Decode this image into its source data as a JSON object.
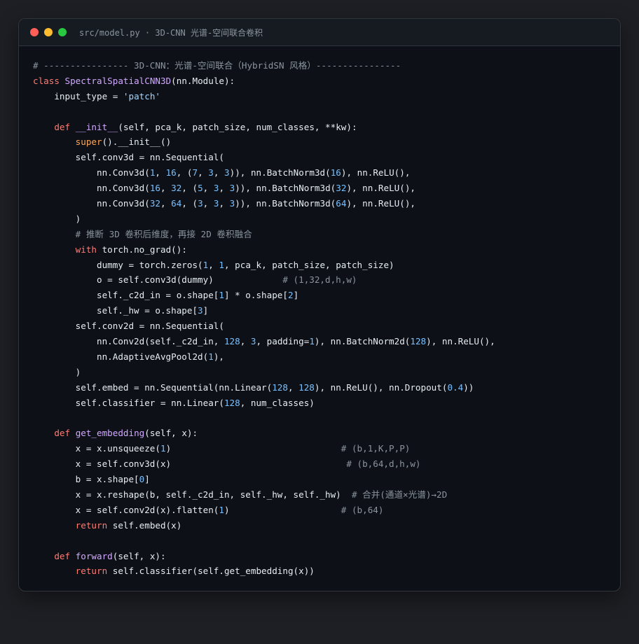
{
  "window": {
    "title": "src/model.py · 3D-CNN 光谱-空间联合卷积"
  },
  "colors": {
    "keyword": "#ff7b72",
    "function": "#d2a8ff",
    "number": "#79c0ff",
    "string": "#a5d6ff",
    "comment": "#8b949e",
    "builtin": "#ffa657",
    "text": "#e6edf3"
  },
  "code_lines": [
    [
      [
        "cm",
        "# ---------------- 3D-CNN：光谱-空间联合（HybridSN 风格）----------------"
      ]
    ],
    [
      [
        "kw",
        "class "
      ],
      [
        "fn",
        "SpectralSpatialCNN3D"
      ],
      [
        "tx",
        "(nn.Module):"
      ]
    ],
    [
      [
        "tx",
        "    input_type = "
      ],
      [
        "str",
        "'patch'"
      ]
    ],
    [],
    [
      [
        "tx",
        "    "
      ],
      [
        "kw",
        "def "
      ],
      [
        "fn",
        "__init__"
      ],
      [
        "tx",
        "(self, pca_k, patch_size, num_classes, **kw):"
      ]
    ],
    [
      [
        "tx",
        "        "
      ],
      [
        "bi",
        "super"
      ],
      [
        "tx",
        "().__init__()"
      ]
    ],
    [
      [
        "tx",
        "        self.conv3d = nn.Sequential("
      ]
    ],
    [
      [
        "tx",
        "            nn.Conv3d("
      ],
      [
        "num",
        "1"
      ],
      [
        "tx",
        ", "
      ],
      [
        "num",
        "16"
      ],
      [
        "tx",
        ", ("
      ],
      [
        "num",
        "7"
      ],
      [
        "tx",
        ", "
      ],
      [
        "num",
        "3"
      ],
      [
        "tx",
        ", "
      ],
      [
        "num",
        "3"
      ],
      [
        "tx",
        ")), nn.BatchNorm3d("
      ],
      [
        "num",
        "16"
      ],
      [
        "tx",
        "), nn.ReLU(),"
      ]
    ],
    [
      [
        "tx",
        "            nn.Conv3d("
      ],
      [
        "num",
        "16"
      ],
      [
        "tx",
        ", "
      ],
      [
        "num",
        "32"
      ],
      [
        "tx",
        ", ("
      ],
      [
        "num",
        "5"
      ],
      [
        "tx",
        ", "
      ],
      [
        "num",
        "3"
      ],
      [
        "tx",
        ", "
      ],
      [
        "num",
        "3"
      ],
      [
        "tx",
        ")), nn.BatchNorm3d("
      ],
      [
        "num",
        "32"
      ],
      [
        "tx",
        "), nn.ReLU(),"
      ]
    ],
    [
      [
        "tx",
        "            nn.Conv3d("
      ],
      [
        "num",
        "32"
      ],
      [
        "tx",
        ", "
      ],
      [
        "num",
        "64"
      ],
      [
        "tx",
        ", ("
      ],
      [
        "num",
        "3"
      ],
      [
        "tx",
        ", "
      ],
      [
        "num",
        "3"
      ],
      [
        "tx",
        ", "
      ],
      [
        "num",
        "3"
      ],
      [
        "tx",
        ")), nn.BatchNorm3d("
      ],
      [
        "num",
        "64"
      ],
      [
        "tx",
        "), nn.ReLU(),"
      ]
    ],
    [
      [
        "tx",
        "        )"
      ]
    ],
    [
      [
        "tx",
        "        "
      ],
      [
        "cm",
        "# 推断 3D 卷积后维度，再接 2D 卷积融合"
      ]
    ],
    [
      [
        "tx",
        "        "
      ],
      [
        "kw",
        "with "
      ],
      [
        "tx",
        "torch.no_grad():"
      ]
    ],
    [
      [
        "tx",
        "            dummy = torch.zeros("
      ],
      [
        "num",
        "1"
      ],
      [
        "tx",
        ", "
      ],
      [
        "num",
        "1"
      ],
      [
        "tx",
        ", pca_k, patch_size, patch_size)"
      ]
    ],
    [
      [
        "tx",
        "            o = self.conv3d(dummy)             "
      ],
      [
        "cm",
        "# (1,32,d,h,w)"
      ]
    ],
    [
      [
        "tx",
        "            self._c2d_in = o.shape["
      ],
      [
        "num",
        "1"
      ],
      [
        "tx",
        "] * o.shape["
      ],
      [
        "num",
        "2"
      ],
      [
        "tx",
        "]"
      ]
    ],
    [
      [
        "tx",
        "            self._hw = o.shape["
      ],
      [
        "num",
        "3"
      ],
      [
        "tx",
        "]"
      ]
    ],
    [
      [
        "tx",
        "        self.conv2d = nn.Sequential("
      ]
    ],
    [
      [
        "tx",
        "            nn.Conv2d(self._c2d_in, "
      ],
      [
        "num",
        "128"
      ],
      [
        "tx",
        ", "
      ],
      [
        "num",
        "3"
      ],
      [
        "tx",
        ", padding="
      ],
      [
        "num",
        "1"
      ],
      [
        "tx",
        "), nn.BatchNorm2d("
      ],
      [
        "num",
        "128"
      ],
      [
        "tx",
        "), nn.ReLU(),"
      ]
    ],
    [
      [
        "tx",
        "            nn.AdaptiveAvgPool2d("
      ],
      [
        "num",
        "1"
      ],
      [
        "tx",
        "),"
      ]
    ],
    [
      [
        "tx",
        "        )"
      ]
    ],
    [
      [
        "tx",
        "        self.embed = nn.Sequential(nn.Linear("
      ],
      [
        "num",
        "128"
      ],
      [
        "tx",
        ", "
      ],
      [
        "num",
        "128"
      ],
      [
        "tx",
        "), nn.ReLU(), nn.Dropout("
      ],
      [
        "num",
        "0.4"
      ],
      [
        "tx",
        "))"
      ]
    ],
    [
      [
        "tx",
        "        self.classifier = nn.Linear("
      ],
      [
        "num",
        "128"
      ],
      [
        "tx",
        ", num_classes)"
      ]
    ],
    [],
    [
      [
        "tx",
        "    "
      ],
      [
        "kw",
        "def "
      ],
      [
        "fn",
        "get_embedding"
      ],
      [
        "tx",
        "(self, x):"
      ]
    ],
    [
      [
        "tx",
        "        x = x.unsqueeze("
      ],
      [
        "num",
        "1"
      ],
      [
        "tx",
        ")                                "
      ],
      [
        "cm",
        "# (b,1,K,P,P)"
      ]
    ],
    [
      [
        "tx",
        "        x = self.conv3d(x)                                 "
      ],
      [
        "cm",
        "# (b,64,d,h,w)"
      ]
    ],
    [
      [
        "tx",
        "        b = x.shape["
      ],
      [
        "num",
        "0"
      ],
      [
        "tx",
        "]"
      ]
    ],
    [
      [
        "tx",
        "        x = x.reshape(b, self._c2d_in, self._hw, self._hw)  "
      ],
      [
        "cm",
        "# 合并(通道×光谱)→2D"
      ]
    ],
    [
      [
        "tx",
        "        x = self.conv2d(x).flatten("
      ],
      [
        "num",
        "1"
      ],
      [
        "tx",
        ")                     "
      ],
      [
        "cm",
        "# (b,64)"
      ]
    ],
    [
      [
        "tx",
        "        "
      ],
      [
        "kw",
        "return "
      ],
      [
        "tx",
        "self.embed(x)"
      ]
    ],
    [],
    [
      [
        "tx",
        "    "
      ],
      [
        "kw",
        "def "
      ],
      [
        "fn",
        "forward"
      ],
      [
        "tx",
        "(self, x):"
      ]
    ],
    [
      [
        "tx",
        "        "
      ],
      [
        "kw",
        "return "
      ],
      [
        "tx",
        "self.classifier(self.get_embedding(x))"
      ]
    ]
  ]
}
